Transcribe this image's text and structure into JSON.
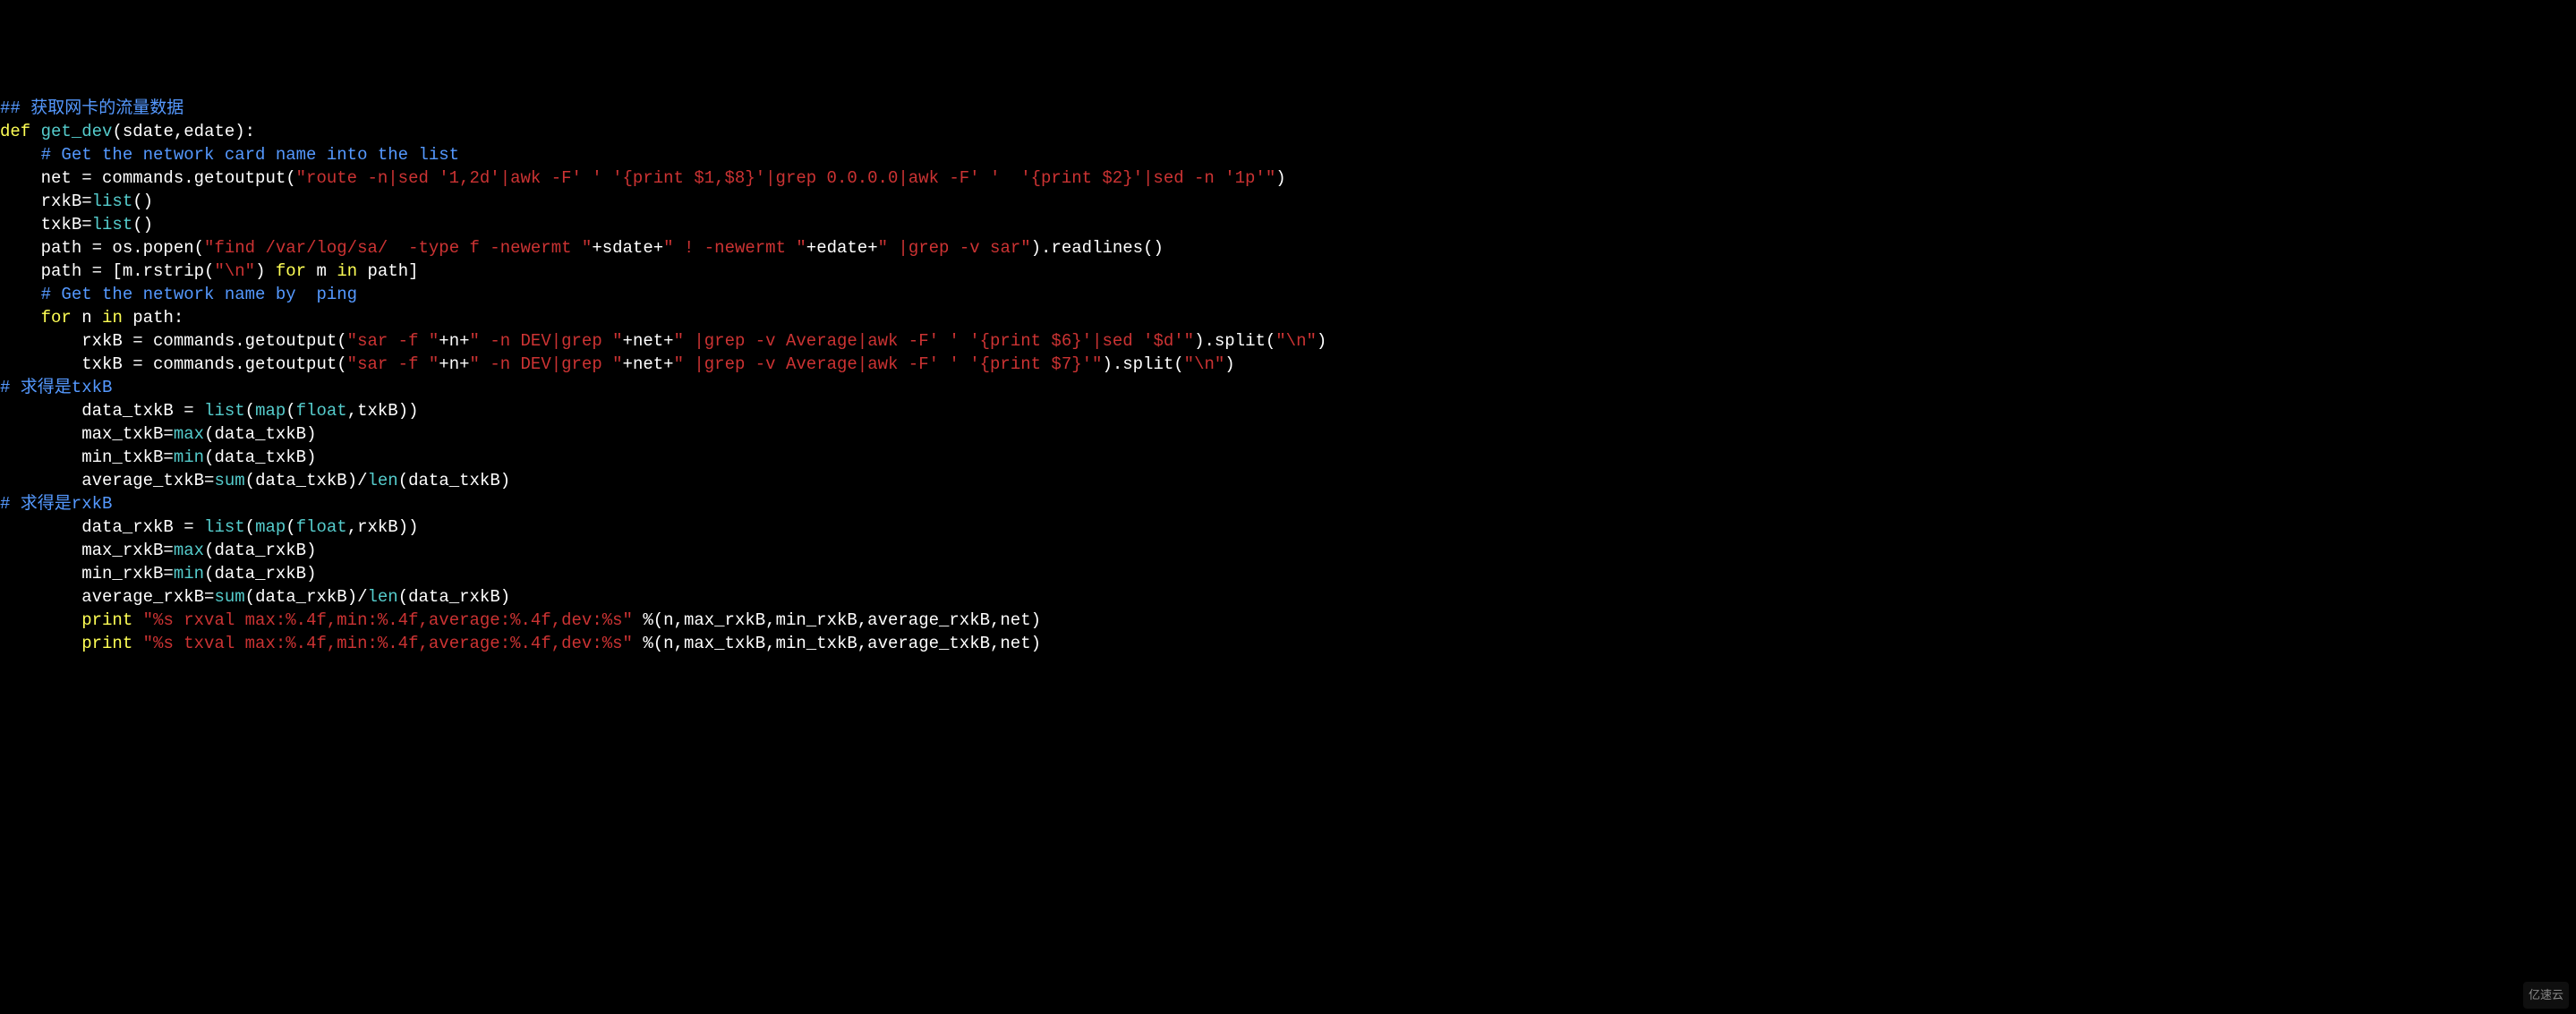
{
  "watermark": "亿速云",
  "lines": [
    {
      "indent": 0,
      "tokens": [
        {
          "cls": "c-comment",
          "t": "## 获取网卡的流量数据"
        }
      ]
    },
    {
      "indent": 0,
      "tokens": [
        {
          "cls": "c-keyword",
          "t": "def"
        },
        {
          "cls": "c-default",
          "t": " "
        },
        {
          "cls": "c-func",
          "t": "get_dev"
        },
        {
          "cls": "c-default",
          "t": "(sdate,edate):"
        }
      ]
    },
    {
      "indent": 4,
      "tokens": [
        {
          "cls": "c-comment",
          "t": "# Get the network card name into the list"
        }
      ]
    },
    {
      "indent": 4,
      "tokens": [
        {
          "cls": "c-default",
          "t": "net = commands.getoutput("
        },
        {
          "cls": "c-string",
          "t": "\"route -n|sed '1,2d'|awk -F' ' '{print $1,$8}'|grep 0.0.0.0|awk -F' '  '{print $2}'|sed -n '1p'\""
        },
        {
          "cls": "c-default",
          "t": ")"
        }
      ]
    },
    {
      "indent": 4,
      "tokens": [
        {
          "cls": "c-default",
          "t": "rxkB="
        },
        {
          "cls": "c-builtin",
          "t": "list"
        },
        {
          "cls": "c-default",
          "t": "()"
        }
      ]
    },
    {
      "indent": 4,
      "tokens": [
        {
          "cls": "c-default",
          "t": "txkB="
        },
        {
          "cls": "c-builtin",
          "t": "list"
        },
        {
          "cls": "c-default",
          "t": "()"
        }
      ]
    },
    {
      "indent": 4,
      "tokens": [
        {
          "cls": "c-default",
          "t": "path = os.popen("
        },
        {
          "cls": "c-string",
          "t": "\"find /var/log/sa/  -type f -newermt \""
        },
        {
          "cls": "c-default",
          "t": "+sdate+"
        },
        {
          "cls": "c-string",
          "t": "\" ! -newermt \""
        },
        {
          "cls": "c-default",
          "t": "+edate+"
        },
        {
          "cls": "c-string",
          "t": "\" |grep -v sar\""
        },
        {
          "cls": "c-default",
          "t": ").readlines()"
        }
      ]
    },
    {
      "indent": 4,
      "tokens": [
        {
          "cls": "c-default",
          "t": "path = [m.rstrip("
        },
        {
          "cls": "c-string",
          "t": "\"\\n\""
        },
        {
          "cls": "c-default",
          "t": ") "
        },
        {
          "cls": "c-keyword",
          "t": "for"
        },
        {
          "cls": "c-default",
          "t": " m "
        },
        {
          "cls": "c-keyword",
          "t": "in"
        },
        {
          "cls": "c-default",
          "t": " path]"
        }
      ]
    },
    {
      "indent": 4,
      "tokens": [
        {
          "cls": "c-comment",
          "t": "# Get the network name by  ping"
        }
      ]
    },
    {
      "indent": 4,
      "tokens": [
        {
          "cls": "c-keyword",
          "t": "for"
        },
        {
          "cls": "c-default",
          "t": " n "
        },
        {
          "cls": "c-keyword",
          "t": "in"
        },
        {
          "cls": "c-default",
          "t": " path:"
        }
      ]
    },
    {
      "indent": 8,
      "tokens": [
        {
          "cls": "c-default",
          "t": "rxkB = commands.getoutput("
        },
        {
          "cls": "c-string",
          "t": "\"sar -f \""
        },
        {
          "cls": "c-default",
          "t": "+n+"
        },
        {
          "cls": "c-string",
          "t": "\" -n DEV|grep \""
        },
        {
          "cls": "c-default",
          "t": "+net+"
        },
        {
          "cls": "c-string",
          "t": "\" |grep -v Average|awk -F' ' '{print $6}'|sed '$d'\""
        },
        {
          "cls": "c-default",
          "t": ").split("
        },
        {
          "cls": "c-string",
          "t": "\"\\n\""
        },
        {
          "cls": "c-default",
          "t": ")"
        }
      ]
    },
    {
      "indent": 8,
      "tokens": [
        {
          "cls": "c-default",
          "t": "txkB = commands.getoutput("
        },
        {
          "cls": "c-string",
          "t": "\"sar -f \""
        },
        {
          "cls": "c-default",
          "t": "+n+"
        },
        {
          "cls": "c-string",
          "t": "\" -n DEV|grep \""
        },
        {
          "cls": "c-default",
          "t": "+net+"
        },
        {
          "cls": "c-string",
          "t": "\" |grep -v Average|awk -F' ' '{print $7}'\""
        },
        {
          "cls": "c-default",
          "t": ").split("
        },
        {
          "cls": "c-string",
          "t": "\"\\n\""
        },
        {
          "cls": "c-default",
          "t": ")"
        }
      ]
    },
    {
      "indent": 0,
      "tokens": [
        {
          "cls": "c-comment",
          "t": "# 求得是txkB"
        }
      ]
    },
    {
      "indent": 8,
      "tokens": [
        {
          "cls": "c-default",
          "t": "data_txkB = "
        },
        {
          "cls": "c-builtin",
          "t": "list"
        },
        {
          "cls": "c-default",
          "t": "("
        },
        {
          "cls": "c-builtin",
          "t": "map"
        },
        {
          "cls": "c-default",
          "t": "("
        },
        {
          "cls": "c-builtin",
          "t": "float"
        },
        {
          "cls": "c-default",
          "t": ",txkB))"
        }
      ]
    },
    {
      "indent": 8,
      "tokens": [
        {
          "cls": "c-default",
          "t": "max_txkB="
        },
        {
          "cls": "c-builtin",
          "t": "max"
        },
        {
          "cls": "c-default",
          "t": "(data_txkB)"
        }
      ]
    },
    {
      "indent": 8,
      "tokens": [
        {
          "cls": "c-default",
          "t": "min_txkB="
        },
        {
          "cls": "c-builtin",
          "t": "min"
        },
        {
          "cls": "c-default",
          "t": "(data_txkB)"
        }
      ]
    },
    {
      "indent": 8,
      "tokens": [
        {
          "cls": "c-default",
          "t": "average_txkB="
        },
        {
          "cls": "c-builtin",
          "t": "sum"
        },
        {
          "cls": "c-default",
          "t": "(data_txkB)/"
        },
        {
          "cls": "c-builtin",
          "t": "len"
        },
        {
          "cls": "c-default",
          "t": "(data_txkB)"
        }
      ]
    },
    {
      "indent": 0,
      "tokens": [
        {
          "cls": "c-comment",
          "t": "# 求得是rxkB"
        }
      ]
    },
    {
      "indent": 8,
      "tokens": [
        {
          "cls": "c-default",
          "t": "data_rxkB = "
        },
        {
          "cls": "c-builtin",
          "t": "list"
        },
        {
          "cls": "c-default",
          "t": "("
        },
        {
          "cls": "c-builtin",
          "t": "map"
        },
        {
          "cls": "c-default",
          "t": "("
        },
        {
          "cls": "c-builtin",
          "t": "float"
        },
        {
          "cls": "c-default",
          "t": ",rxkB))"
        }
      ]
    },
    {
      "indent": 8,
      "tokens": [
        {
          "cls": "c-default",
          "t": "max_rxkB="
        },
        {
          "cls": "c-builtin",
          "t": "max"
        },
        {
          "cls": "c-default",
          "t": "(data_rxkB)"
        }
      ]
    },
    {
      "indent": 8,
      "tokens": [
        {
          "cls": "c-default",
          "t": "min_rxkB="
        },
        {
          "cls": "c-builtin",
          "t": "min"
        },
        {
          "cls": "c-default",
          "t": "(data_rxkB)"
        }
      ]
    },
    {
      "indent": 8,
      "tokens": [
        {
          "cls": "c-default",
          "t": "average_rxkB="
        },
        {
          "cls": "c-builtin",
          "t": "sum"
        },
        {
          "cls": "c-default",
          "t": "(data_rxkB)/"
        },
        {
          "cls": "c-builtin",
          "t": "len"
        },
        {
          "cls": "c-default",
          "t": "(data_rxkB)"
        }
      ]
    },
    {
      "indent": 8,
      "tokens": [
        {
          "cls": "c-keyword",
          "t": "print"
        },
        {
          "cls": "c-default",
          "t": " "
        },
        {
          "cls": "c-string",
          "t": "\"%s rxval max:%.4f,min:%.4f,average:%.4f,dev:%s\""
        },
        {
          "cls": "c-default",
          "t": " %(n,max_rxkB,min_rxkB,average_rxkB,net)"
        }
      ]
    },
    {
      "indent": 8,
      "tokens": [
        {
          "cls": "c-keyword",
          "t": "print"
        },
        {
          "cls": "c-default",
          "t": " "
        },
        {
          "cls": "c-string",
          "t": "\"%s txval max:%.4f,min:%.4f,average:%.4f,dev:%s\""
        },
        {
          "cls": "c-default",
          "t": " %(n,max_txkB,min_txkB,average_txkB,net)"
        }
      ]
    }
  ]
}
